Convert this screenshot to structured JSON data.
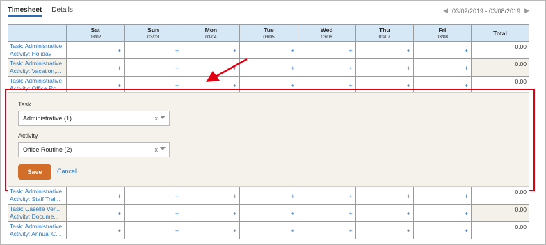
{
  "tabs": [
    {
      "label": "Timesheet",
      "active": true
    },
    {
      "label": "Details",
      "active": false
    }
  ],
  "date_range": "03/02/2019 - 03/08/2019",
  "columns": [
    {
      "day": "Sat",
      "date": "03/02"
    },
    {
      "day": "Sun",
      "date": "03/03"
    },
    {
      "day": "Mon",
      "date": "03/04"
    },
    {
      "day": "Tue",
      "date": "03/05"
    },
    {
      "day": "Wed",
      "date": "03/06"
    },
    {
      "day": "Thu",
      "date": "03/07"
    },
    {
      "day": "Fri",
      "date": "03/08"
    }
  ],
  "total_label": "Total",
  "plus_glyph": "+",
  "rows_top": [
    {
      "task": "Task: Administrative",
      "activity": "Activity: Holiday",
      "total": "0.00"
    },
    {
      "task": "Task: Administrative",
      "activity": "Activity: Vacation,...",
      "total": "0.00"
    },
    {
      "task": "Task: Administrative",
      "activity": "Activity: Office Ro...",
      "total": "0.00"
    }
  ],
  "rows_bottom": [
    {
      "task": "Task: Administrative",
      "activity": "Activity: Staff Trai...",
      "total": "0.00"
    },
    {
      "task": "Task: Caselle Ver...",
      "activity": "Activity: Docume...",
      "total": "0.00"
    },
    {
      "task": "Task: Administrative",
      "activity": "Activity: Annual C...",
      "total": "0.00"
    }
  ],
  "edit_panel": {
    "task_label": "Task",
    "task_value": "Administrative (1)",
    "activity_label": "Activity",
    "activity_value": "Office Routine (2)",
    "clear_glyph": "x",
    "save_label": "Save",
    "cancel_label": "Cancel"
  },
  "colors": {
    "header_bg": "#d6e7f6",
    "link": "#2b73b8",
    "save_bg": "#d26e2a",
    "annotation": "#e00012",
    "row_shade": "#f3f1e9"
  }
}
